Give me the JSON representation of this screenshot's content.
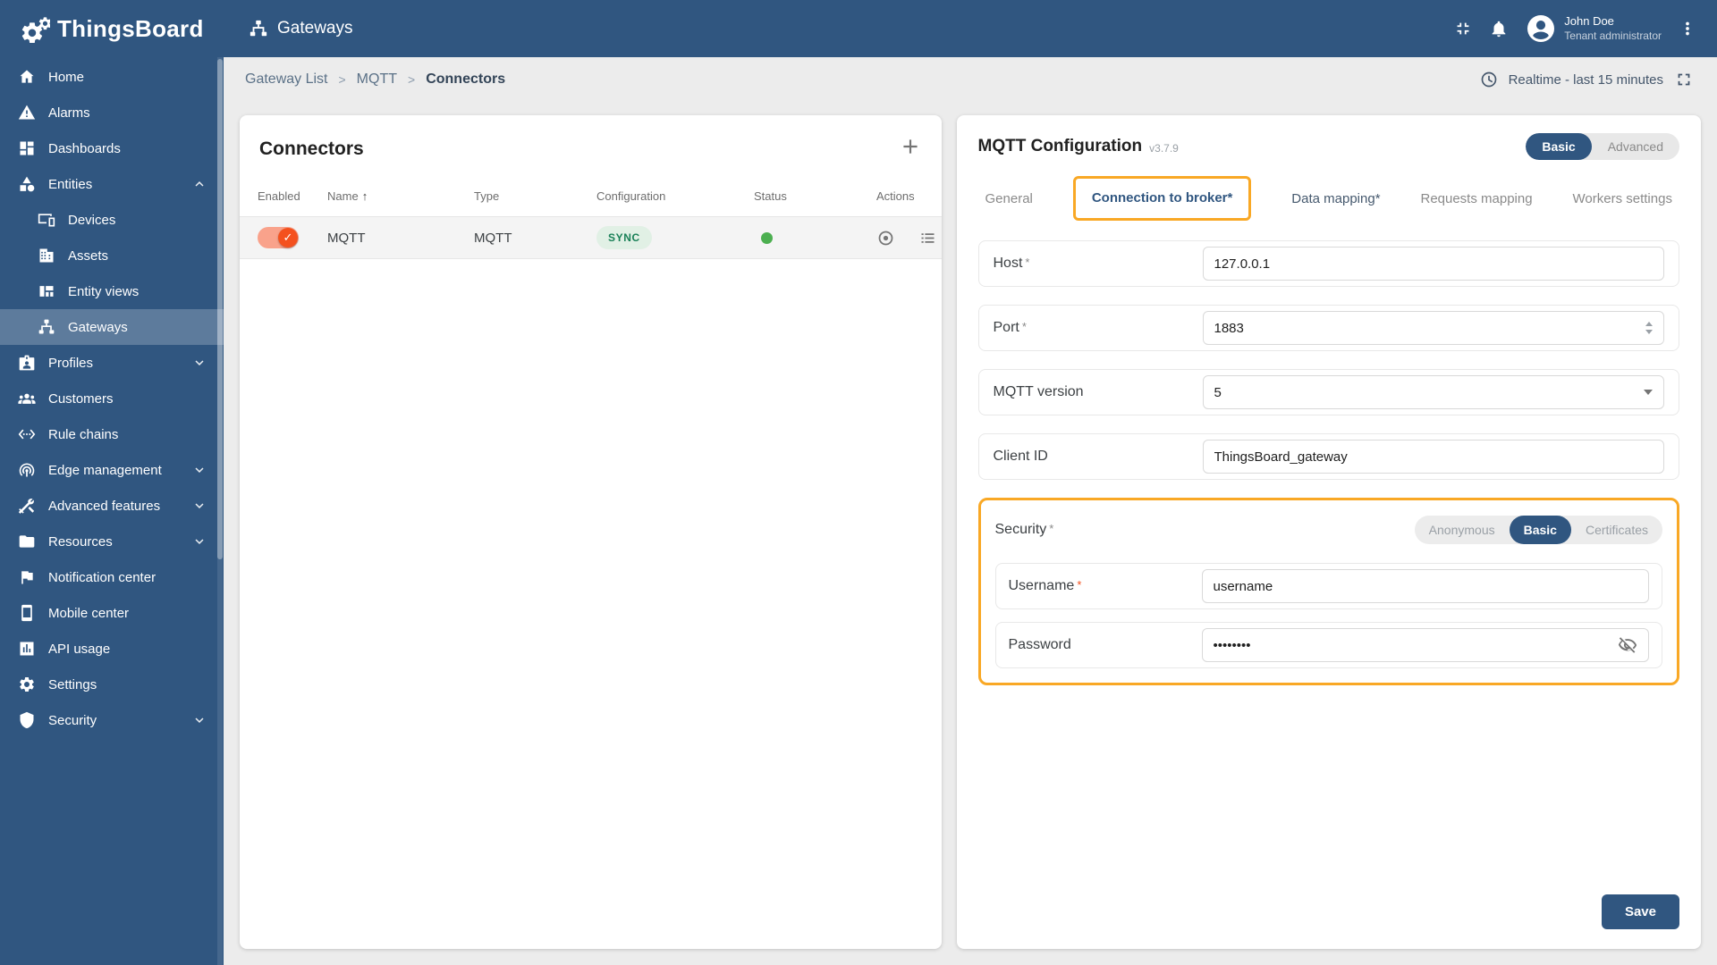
{
  "colors": {
    "primary": "#305680",
    "annotation_highlight": "#F9A825",
    "toggle_on": "#F4511E",
    "status_ok": "#4CAF50",
    "chip_bg": "#E1F0E5",
    "chip_text": "#198057"
  },
  "icons": {
    "sort_asc": "↑",
    "check": "✓",
    "required_marker": "*"
  },
  "header": {
    "brand": "ThingsBoard",
    "page_title": "Gateways",
    "user_name": "John Doe",
    "user_role": "Tenant administrator"
  },
  "toolbar": {
    "breadcrumb": [
      "Gateway List",
      "MQTT",
      "Connectors"
    ],
    "separator": ">",
    "time_range": "Realtime - last 15 minutes"
  },
  "sidebar": {
    "items": [
      {
        "label": "Home",
        "icon": "home"
      },
      {
        "label": "Alarms",
        "icon": "warning"
      },
      {
        "label": "Dashboards",
        "icon": "dashboard"
      },
      {
        "label": "Entities",
        "icon": "category",
        "expanded": true
      },
      {
        "label": "Devices",
        "icon": "devices",
        "child": true
      },
      {
        "label": "Assets",
        "icon": "building",
        "child": true
      },
      {
        "label": "Entity views",
        "icon": "view-quilt",
        "child": true
      },
      {
        "label": "Gateways",
        "icon": "lan",
        "child": true,
        "active": true
      },
      {
        "label": "Profiles",
        "icon": "badge",
        "expandable": true
      },
      {
        "label": "Customers",
        "icon": "groups"
      },
      {
        "label": "Rule chains",
        "icon": "settings-ethernet"
      },
      {
        "label": "Edge management",
        "icon": "wifi-tethering",
        "expandable": true
      },
      {
        "label": "Advanced features",
        "icon": "construction",
        "expandable": true
      },
      {
        "label": "Resources",
        "icon": "folder",
        "expandable": true
      },
      {
        "label": "Notification center",
        "icon": "flag"
      },
      {
        "label": "Mobile center",
        "icon": "smartphone"
      },
      {
        "label": "API usage",
        "icon": "insert-chart"
      },
      {
        "label": "Settings",
        "icon": "settings"
      },
      {
        "label": "Security",
        "icon": "shield",
        "expandable": true
      }
    ]
  },
  "connectors": {
    "title": "Connectors",
    "columns": [
      "Enabled",
      "Name",
      "Type",
      "Configuration",
      "Status",
      "Actions"
    ],
    "rows": [
      {
        "enabled": true,
        "name": "MQTT",
        "type": "MQTT",
        "configuration": "SYNC",
        "status": "active"
      }
    ]
  },
  "config": {
    "title": "MQTT Configuration",
    "version": "v3.7.9",
    "modes": {
      "options": [
        "Basic",
        "Advanced"
      ],
      "selected": "Basic"
    },
    "tabs": [
      {
        "label": "General"
      },
      {
        "label": "Connection to broker*",
        "active": true
      },
      {
        "label": "Data mapping*"
      },
      {
        "label": "Requests mapping"
      },
      {
        "label": "Workers settings"
      }
    ],
    "fields": {
      "host": {
        "label": "Host",
        "required": true,
        "value": "127.0.0.1"
      },
      "port": {
        "label": "Port",
        "required": true,
        "value": "1883"
      },
      "mqtt_version": {
        "label": "MQTT version",
        "value": "5"
      },
      "client_id": {
        "label": "Client ID",
        "value": "ThingsBoard_gateway"
      }
    },
    "security": {
      "label": "Security",
      "required": true,
      "options": [
        "Anonymous",
        "Basic",
        "Certificates"
      ],
      "selected": "Basic",
      "username": {
        "label": "Username",
        "required": true,
        "value": "username"
      },
      "password": {
        "label": "Password",
        "value": "••••••••"
      }
    },
    "save_label": "Save"
  }
}
